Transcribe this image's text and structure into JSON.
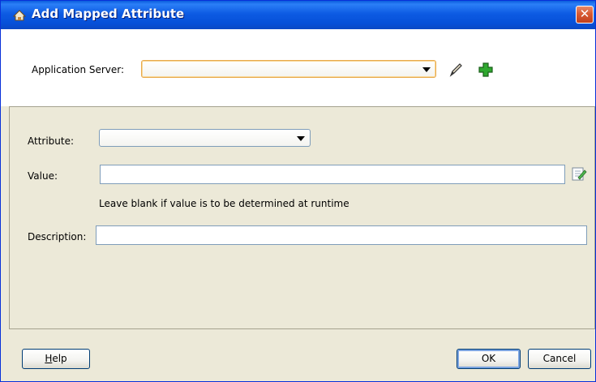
{
  "window": {
    "title": "Add Mapped Attribute",
    "close_glyph": "✕"
  },
  "app_server": {
    "label": "Application Server:",
    "value": "",
    "edit_icon": "pencil-icon",
    "add_icon": "plus-icon"
  },
  "attribute": {
    "label": "Attribute:",
    "value": ""
  },
  "value_field": {
    "label": "Value:",
    "value": "",
    "hint": "Leave blank if value is to be determined at runtime",
    "edit_icon": "edit-note-icon"
  },
  "description": {
    "label": "Description:",
    "value": ""
  },
  "buttons": {
    "help_mnemonic": "H",
    "help_rest": "elp",
    "ok": "OK",
    "cancel": "Cancel"
  },
  "colors": {
    "titlebar": "#0a5ddd",
    "dialog_bg": "#ece9d8",
    "add_icon": "#2fa82f"
  }
}
